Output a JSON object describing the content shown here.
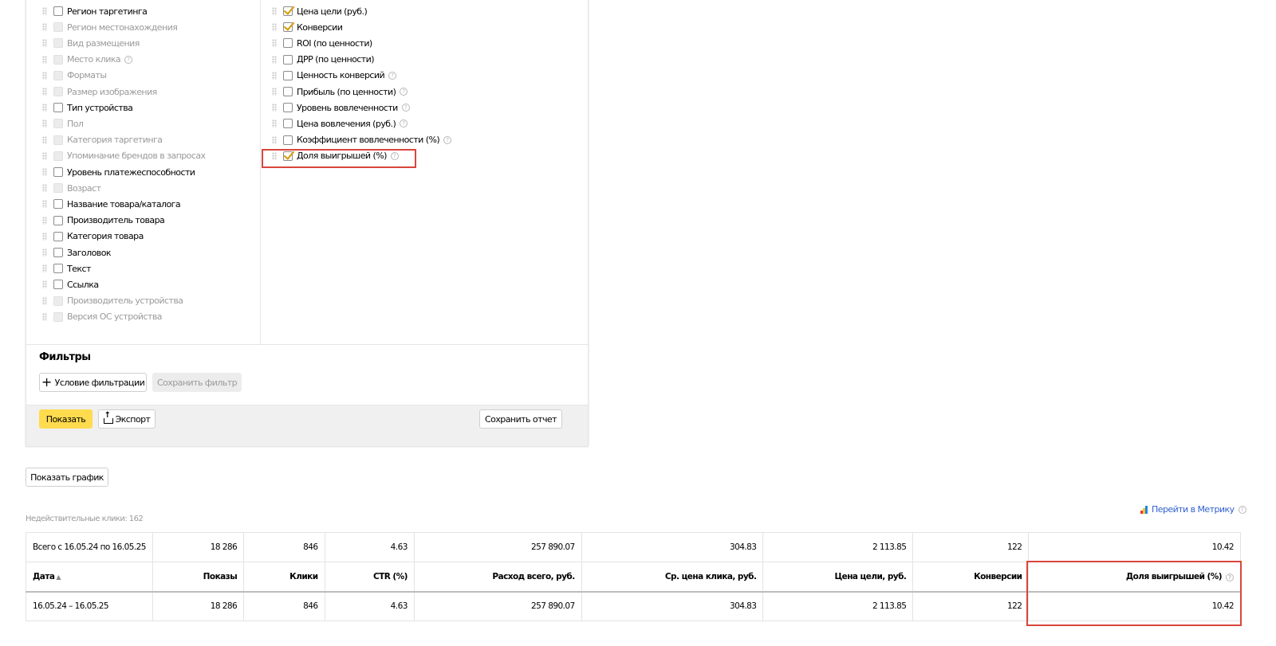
{
  "groupings": [
    {
      "label": "Регион таргетинга",
      "enabled": true
    },
    {
      "label": "Регион местонахождения",
      "enabled": false
    },
    {
      "label": "Вид размещения",
      "enabled": false
    },
    {
      "label": "Место клика",
      "enabled": false,
      "help": true
    },
    {
      "label": "Форматы",
      "enabled": false
    },
    {
      "label": "Размер изображения",
      "enabled": false
    },
    {
      "label": "Тип устройства",
      "enabled": true
    },
    {
      "label": "Пол",
      "enabled": false
    },
    {
      "label": "Категория таргетинга",
      "enabled": false
    },
    {
      "label": "Упоминание брендов в запросах",
      "enabled": false
    },
    {
      "label": "Уровень платежеспособности",
      "enabled": true
    },
    {
      "label": "Возраст",
      "enabled": false
    },
    {
      "label": "Название товара/каталога",
      "enabled": true
    },
    {
      "label": "Производитель товара",
      "enabled": true
    },
    {
      "label": "Категория товара",
      "enabled": true
    },
    {
      "label": "Заголовок",
      "enabled": true
    },
    {
      "label": "Текст",
      "enabled": true
    },
    {
      "label": "Ссылка",
      "enabled": true
    },
    {
      "label": "Производитель устройства",
      "enabled": false
    },
    {
      "label": "Версия ОС устройства",
      "enabled": false
    }
  ],
  "metrics": [
    {
      "label": "Цена цели (руб.)",
      "checked": true
    },
    {
      "label": "Конверсии",
      "checked": true
    },
    {
      "label": "ROI (по ценности)",
      "checked": false
    },
    {
      "label": "ДРР (по ценности)",
      "checked": false
    },
    {
      "label": "Ценность конверсий",
      "checked": false,
      "help": true
    },
    {
      "label": "Прибыль (по ценности)",
      "checked": false,
      "help": true
    },
    {
      "label": "Уровень вовлеченности",
      "checked": false,
      "help": true
    },
    {
      "label": "Цена вовлечения (руб.)",
      "checked": false,
      "help": true
    },
    {
      "label": "Коэффициент вовлеченности (%)",
      "checked": false,
      "help": true
    },
    {
      "label": "Доля выигрышей (%)",
      "checked": true,
      "help": true
    }
  ],
  "filters": {
    "title": "Фильтры",
    "add_condition": "Условие фильтрации",
    "save_filter": "Сохранить фильтр"
  },
  "actions": {
    "show": "Показать",
    "export": "Экспорт",
    "save_report": "Сохранить отчет",
    "show_chart": "Показать график"
  },
  "invalid_clicks": "Недействительные клики: 162",
  "metrika_link": "Перейти в Метрику",
  "table": {
    "headers": [
      "Дата",
      "Показы",
      "Клики",
      "CTR (%)",
      "Расход всего, руб.",
      "Ср. цена клика, руб.",
      "Цена цели, руб.",
      "Конверсии",
      "Доля выигрышей (%)"
    ],
    "total": [
      "Всего с 16.05.24 по 16.05.25",
      "18 286",
      "846",
      "4.63",
      "257 890.07",
      "304.83",
      "2 113.85",
      "122",
      "10.42"
    ],
    "rows": [
      [
        "16.05.24 – 16.05.25",
        "18 286",
        "846",
        "4.63",
        "257 890.07",
        "304.83",
        "2 113.85",
        "122",
        "10.42"
      ]
    ]
  },
  "colors": {
    "accent": "#ffdb4d",
    "highlight": "#d9463c",
    "link": "#2f5fd0",
    "check": "#d49a00"
  }
}
